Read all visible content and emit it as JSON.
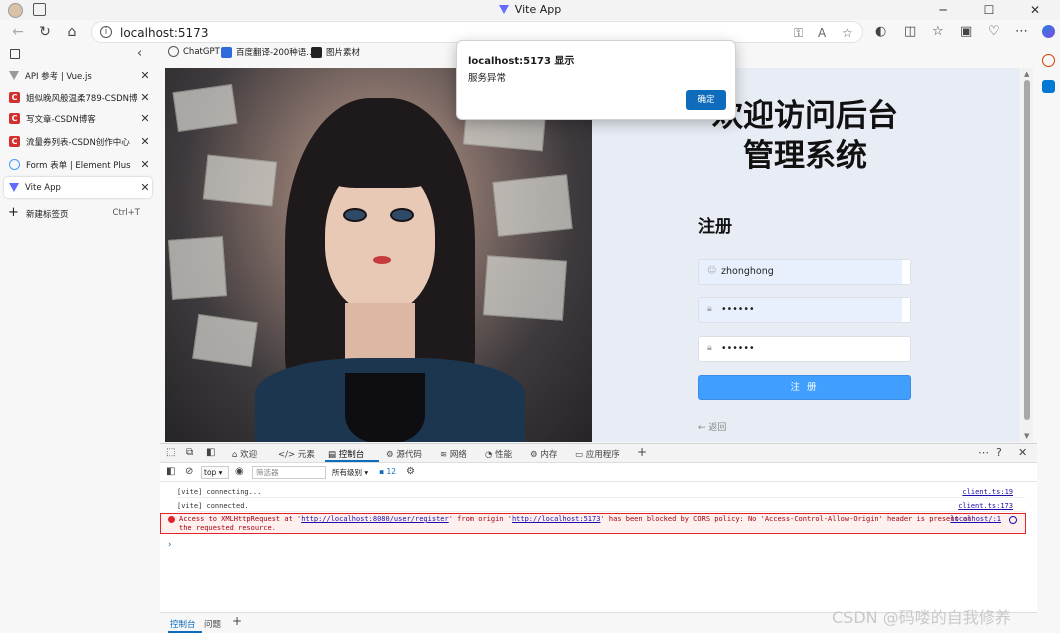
{
  "window": {
    "title": "Vite App"
  },
  "address": {
    "url": "localhost:5173"
  },
  "sidebar": {
    "tabs": [
      {
        "label": "API 参考 | Vue.js",
        "icon": "vue-favicon-icon"
      },
      {
        "label": "姐似晚风般温柔789-CSDN博客",
        "icon": "csdn-favicon-icon"
      },
      {
        "label": "写文章-CSDN博客",
        "icon": "csdn-favicon-icon"
      },
      {
        "label": "流量券列表-CSDN创作中心",
        "icon": "csdn-favicon-icon"
      },
      {
        "label": "Form 表单 | Element Plus",
        "icon": "element-plus-favicon-icon"
      },
      {
        "label": "Vite App",
        "icon": "vite-favicon-icon"
      }
    ],
    "new_tab": {
      "label": "新建标签页",
      "shortcut": "Ctrl+T"
    }
  },
  "bookmarks": [
    {
      "label": "ChatGPT"
    },
    {
      "label": "百度翻译-200种语..."
    },
    {
      "label": "图片素材"
    }
  ],
  "page": {
    "title_line1": "欢迎访问后台",
    "title_line2": "管理系统",
    "form_title": "注册",
    "username_value": "zhonghong",
    "password_value": "••••••",
    "confirm_value": "••••••",
    "submit_label": "注 册",
    "back_label": "← 返回"
  },
  "alert": {
    "title": "localhost:5173 显示",
    "message": "服务异常",
    "ok_label": "确定"
  },
  "devtools": {
    "tabs": [
      "欢迎",
      "元素",
      "控制台",
      "源代码",
      "网络",
      "性能",
      "内存",
      "应用程序"
    ],
    "context": "top",
    "filter_placeholder": "筛选器",
    "levels": "所有级别 ▾",
    "issues_count": "12",
    "console": [
      {
        "msg": "[vite] connecting...",
        "src": "client.ts:19"
      },
      {
        "msg": "[vite] connected.",
        "src": "client.ts:173"
      }
    ],
    "error": {
      "pre": "Access to XMLHttpRequest at '",
      "url1": "http://localhost:8080/user/register",
      "mid": "' from origin '",
      "url2": "http://localhost:5173",
      "post": "' has been blocked by CORS policy: No 'Access-Control-Allow-Origin' header is present on",
      "line2": "the requested resource.",
      "src": "localhost/:1"
    },
    "drawer_tabs": [
      "控制台",
      "问题"
    ]
  },
  "watermark": "CSDN @码喽的自我修养",
  "colors": {
    "accent": "#409eff",
    "edge_blue": "#0f6cbd",
    "error": "#e0242a"
  }
}
